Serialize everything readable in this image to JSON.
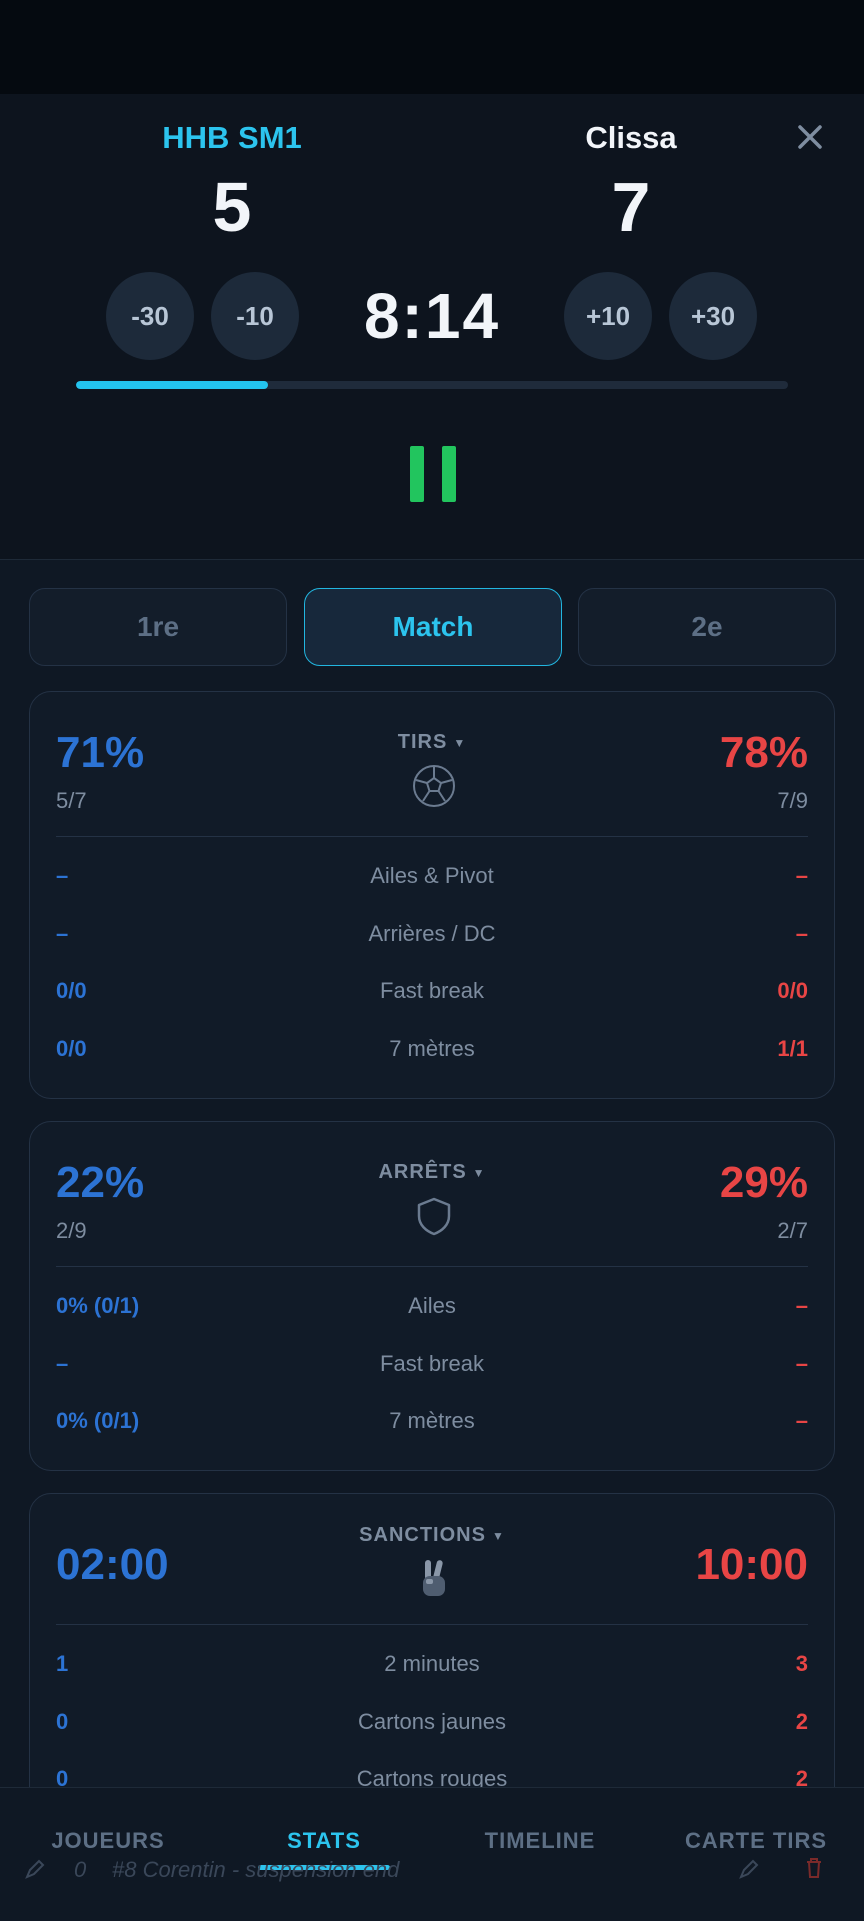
{
  "header": {
    "home_team": "HHB SM1",
    "away_team": "Clissa",
    "home_score": "5",
    "away_score": "7",
    "clock": "8:14",
    "adjust_buttons": [
      "-30",
      "-10",
      "+10",
      "+30"
    ],
    "half_progress": 0.27
  },
  "tabs": [
    {
      "label": "1re",
      "active": false
    },
    {
      "label": "Match",
      "active": true
    },
    {
      "label": "2e",
      "active": false
    }
  ],
  "shots": {
    "title": "TIRS",
    "home_pct": "71%",
    "away_pct": "78%",
    "home_ratio": "5/7",
    "away_ratio": "7/9",
    "rows": [
      {
        "label": "Ailes & Pivot",
        "home": "–",
        "away": "–"
      },
      {
        "label": "Arrières / DC",
        "home": "–",
        "away": "–"
      },
      {
        "label": "Fast break",
        "home": "0/0",
        "away": "0/0"
      },
      {
        "label": "7 mètres",
        "home": "0/0",
        "away": "1/1"
      }
    ]
  },
  "saves": {
    "title": "ARRÊTS",
    "home_pct": "22%",
    "away_pct": "29%",
    "home_ratio": "2/9",
    "away_ratio": "2/7",
    "rows": [
      {
        "label": "Ailes",
        "home": "0% (0/1)",
        "away": "–"
      },
      {
        "label": "Fast break",
        "home": "–",
        "away": "–"
      },
      {
        "label": "7 mètres",
        "home": "0% (0/1)",
        "away": "–"
      }
    ]
  },
  "sanctions": {
    "title": "SANCTIONS",
    "home_time": "02:00",
    "away_time": "10:00",
    "rows": [
      {
        "label": "2 minutes",
        "home": "1",
        "away": "3"
      },
      {
        "label": "Cartons jaunes",
        "home": "0",
        "away": "2"
      },
      {
        "label": "Cartons rouges",
        "home": "0",
        "away": "2"
      }
    ]
  },
  "bottom_nav": [
    {
      "label": "JOUEURS",
      "active": false
    },
    {
      "label": "STATS",
      "active": true
    },
    {
      "label": "TIMELINE",
      "active": false
    },
    {
      "label": "CARTE TIRS",
      "active": false
    }
  ],
  "peek_text": "#8 Corentin - suspension end",
  "peek_minute": "0",
  "colors": {
    "accent": "#2cc4ee",
    "home": "#2c73d4",
    "away": "#e84545",
    "play": "#22c55e"
  }
}
